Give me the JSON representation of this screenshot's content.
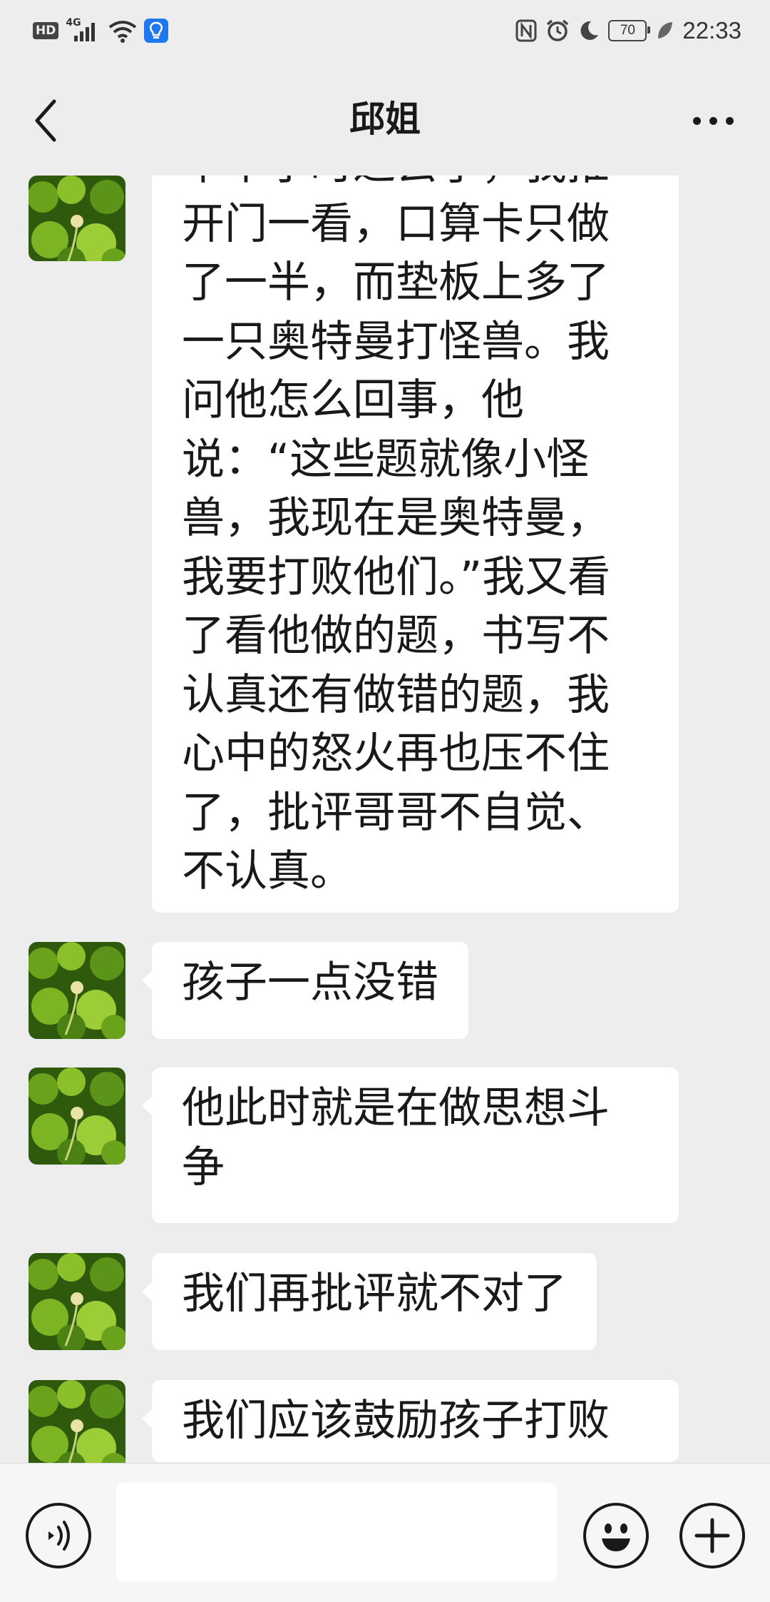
{
  "status_bar": {
    "hd_label": "HD",
    "network_label": "4G",
    "battery": "70",
    "time": "22:33"
  },
  "header": {
    "title": "邱姐"
  },
  "messages": [
    {
      "text": "半个小时过去了，我推开门一看，口算卡只做了一半，而垫板上多了一只奥特曼打怪兽。我问他怎么回事，他说：“这些题就像小怪兽，我现在是奥特曼，我要打败他们。”我又看了看他做的题，书写不认真还有做错的题，我心中的怒火再也压不住了，批评哥哥不自觉、不认真。"
    },
    {
      "text": "孩子一点没错"
    },
    {
      "text": "他此时就是在做思想斗争"
    },
    {
      "text": "我们再批评就不对了"
    },
    {
      "text": "我们应该鼓励孩子打败"
    }
  ],
  "input": {
    "value": ""
  },
  "colors": {
    "background": "#ededed",
    "bubble": "#ffffff",
    "text": "#191919"
  }
}
